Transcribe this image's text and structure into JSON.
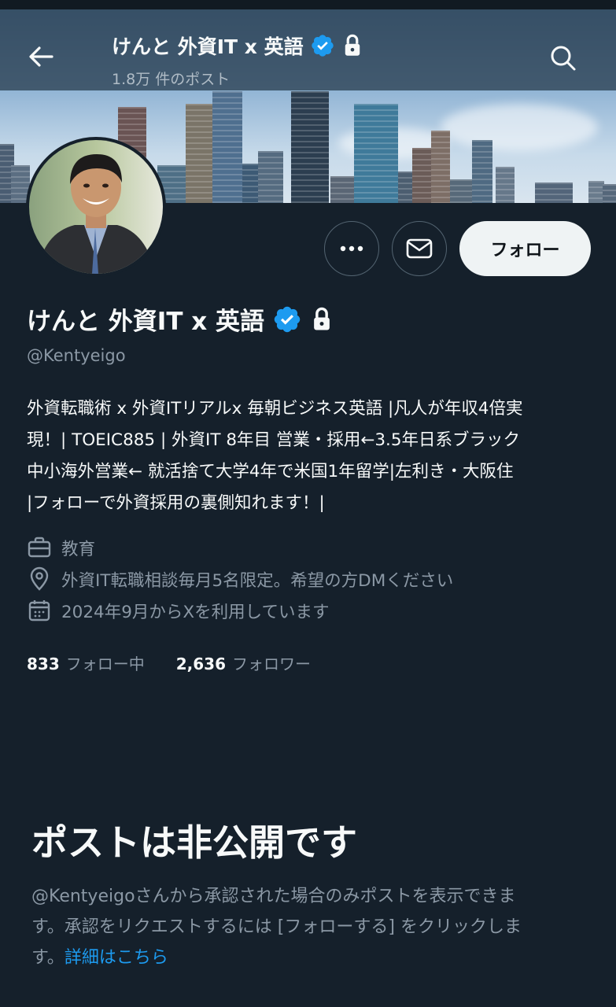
{
  "header": {
    "title": "けんと 外資IT x 英語",
    "post_count": "1.8万 件のポスト",
    "back_icon": "back-arrow-icon",
    "search_icon": "search-icon"
  },
  "profile": {
    "display_name": "けんと 外資IT x 英語",
    "handle": "@Kentyeigo",
    "verified": true,
    "protected": true,
    "bio_lines": [
      "外資転職術 x 外資ITリアルx 毎朝ビジネス英語 |凡人が年収4倍実",
      "現！| TOEIC885 | 外資IT 8年目 営業・採用←3.5年日系ブラック",
      "中小海外営業← 就活捨て大学4年で米国1年留学|左利き・大阪住",
      "|フォローで外資採用の裏側知れます！|"
    ],
    "category": "教育",
    "location": "外資IT転職相談毎月5名限定。希望の方DMください",
    "joined": "2024年9月からXを利用しています"
  },
  "actions": {
    "more_icon": "more-icon",
    "message_icon": "mail-icon",
    "follow_label": "フォロー"
  },
  "stats": {
    "following_count": "833",
    "following_label": "フォロー中",
    "followers_count": "2,636",
    "followers_label": "フォロワー"
  },
  "private_notice": {
    "title": "ポストは非公開です",
    "desc_lines": [
      "@Kentyeigoさんから承認された場合のみポストを表示できま",
      "す。承認をリクエストするには [フォローする] をクリックしま"
    ],
    "desc_tail": "す。",
    "link_label": "詳細はこちら"
  },
  "colors": {
    "background": "#15202b",
    "accent": "#1d9bf0",
    "muted_text": "#8b98a5",
    "follow_button_bg": "#eff3f4"
  }
}
